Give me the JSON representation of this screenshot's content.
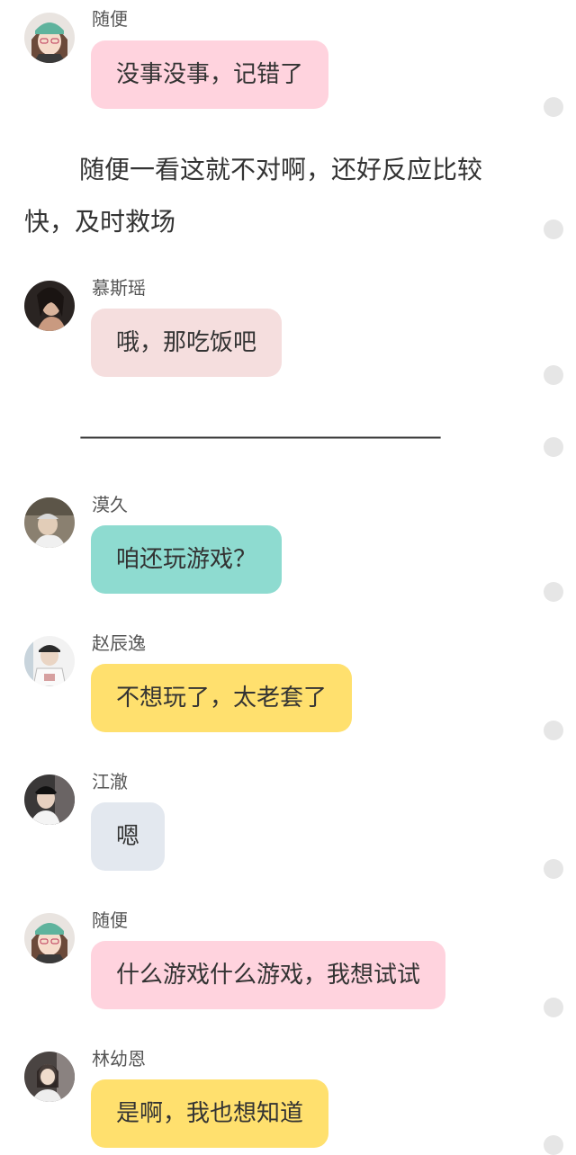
{
  "messages": [
    {
      "sender": "随便",
      "text": "没事没事，记错了",
      "bubble_color": "#ffd3de"
    },
    {
      "sender": "慕斯瑶",
      "text": "哦，那吃饭吧",
      "bubble_color": "#f5dede"
    },
    {
      "sender": "漠久",
      "text": "咱还玩游戏？",
      "bubble_color": "#8edbd0"
    },
    {
      "sender": "赵辰逸",
      "text": "不想玩了，太老套了",
      "bubble_color": "#ffe06e"
    },
    {
      "sender": "江澈",
      "text": "嗯",
      "bubble_color": "#e3e8ef"
    },
    {
      "sender": "随便",
      "text": "什么游戏什么游戏，我想试试",
      "bubble_color": "#ffd3de"
    },
    {
      "sender": "林幼恩",
      "text": "是啊，我也想知道",
      "bubble_color": "#ffe06e"
    }
  ],
  "narration": "随便一看这就不对啊，还好反应比较快，及时救场",
  "divider": "————————————————",
  "colors": {
    "background": "#ffffff",
    "dot": "#e6e6e6"
  }
}
